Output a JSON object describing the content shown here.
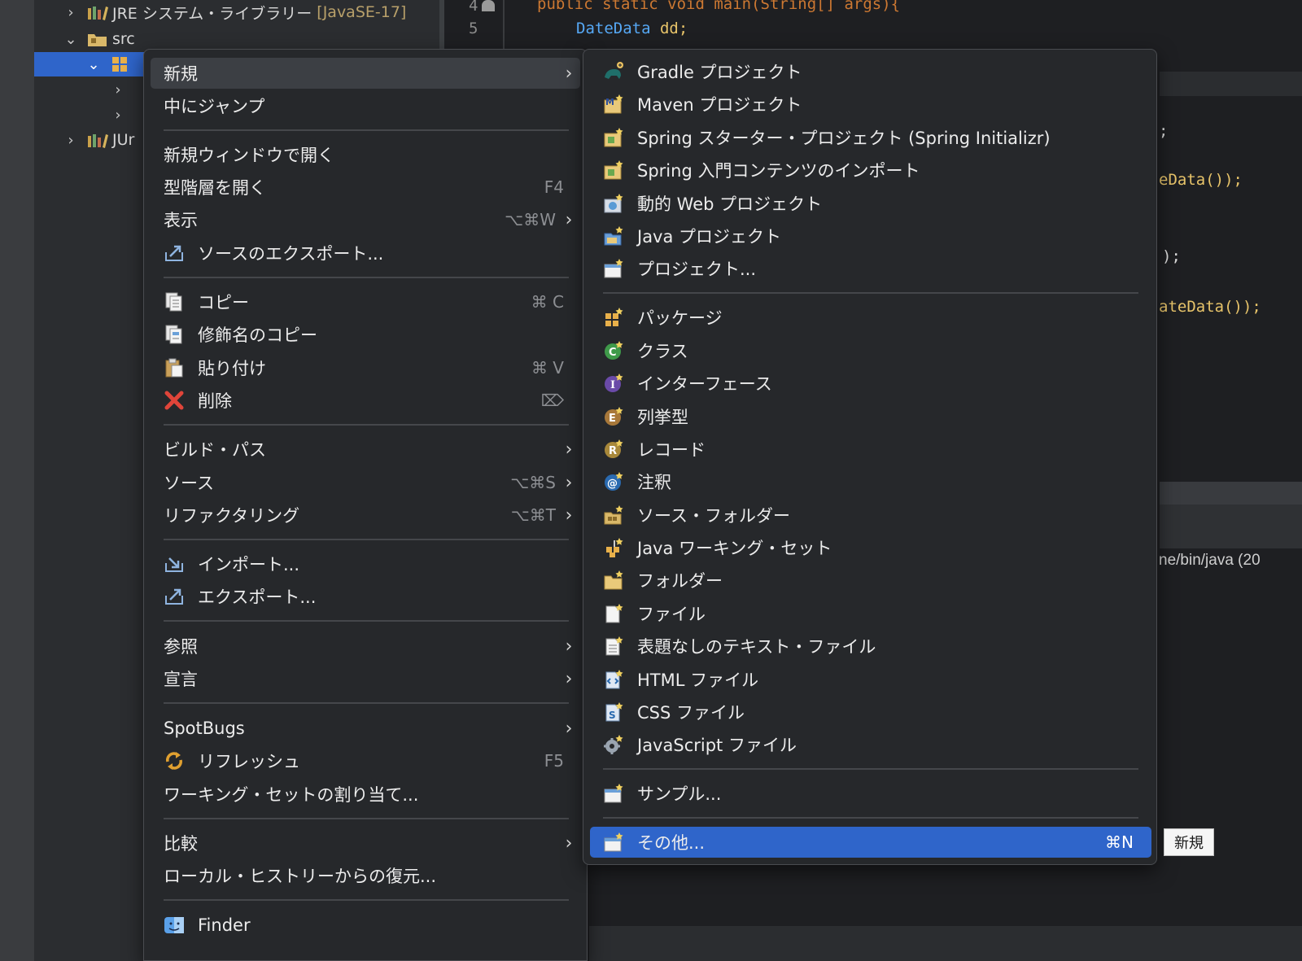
{
  "explorer": {
    "jre_label": "JRE システム・ライブラリー",
    "jre_version": "[JavaSE-17]",
    "src_label": "src",
    "junit_label": "JUr"
  },
  "editor": {
    "line4_num": "4",
    "line5_num": "5",
    "line4_code": "public static void main(String[] args){",
    "line5_type": "DateData",
    "line5_var": "dd;",
    "frag1": ";",
    "frag2": "eData());",
    "frag3": ");",
    "frag4": "ateData());",
    "frag5": "ne/bin/java  (20"
  },
  "context_menu": {
    "new": "新規",
    "goto_into": "中にジャンプ",
    "open_new_window": "新規ウィンドウで開く",
    "open_type_hierarchy": "型階層を開く",
    "open_type_hierarchy_sc": "F4",
    "show_in": "表示",
    "show_in_sc": "⌥⌘W",
    "export_source": "ソースのエクスポート...",
    "copy": "コピー",
    "copy_sc": "⌘ C",
    "copy_qualified": "修飾名のコピー",
    "paste": "貼り付け",
    "paste_sc": "⌘ V",
    "delete": "削除",
    "delete_sc": "⌦",
    "build_path": "ビルド・パス",
    "source": "ソース",
    "source_sc": "⌥⌘S",
    "refactor": "リファクタリング",
    "refactor_sc": "⌥⌘T",
    "import": "インポート...",
    "export": "エクスポート...",
    "references": "参照",
    "declarations": "宣言",
    "spotbugs": "SpotBugs",
    "refresh": "リフレッシュ",
    "refresh_sc": "F5",
    "assign_working_set": "ワーキング・セットの割り当て...",
    "compare": "比較",
    "restore_local_history": "ローカル・ヒストリーからの復元...",
    "finder": "Finder"
  },
  "submenu": {
    "gradle_project": "Gradle プロジェクト",
    "maven_project": "Maven プロジェクト",
    "spring_starter": "Spring スターター・プロジェクト (Spring Initializr)",
    "spring_import": "Spring 入門コンテンツのインポート",
    "dynamic_web": "動的 Web プロジェクト",
    "java_project": "Java プロジェクト",
    "project": "プロジェクト...",
    "package": "パッケージ",
    "class": "クラス",
    "interface": "インターフェース",
    "enum": "列挙型",
    "record": "レコード",
    "annotation": "注釈",
    "source_folder": "ソース・フォルダー",
    "java_working_set": "Java ワーキング・セット",
    "folder": "フォルダー",
    "file": "ファイル",
    "untitled_text": "表題なしのテキスト・ファイル",
    "html_file": "HTML ファイル",
    "css_file": "CSS ファイル",
    "js_file": "JavaScript ファイル",
    "example": "サンプル...",
    "other": "その他...",
    "other_sc": "⌘N"
  },
  "tooltip": "新規",
  "colors": {
    "selection_blue": "#2f65ca",
    "menu_bg": "#26282b",
    "keyword": "#cc7832",
    "type": "#56a8f5"
  }
}
